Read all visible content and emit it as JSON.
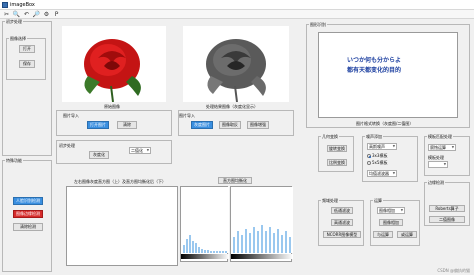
{
  "window": {
    "title": "imageBox"
  },
  "toolbar": {
    "tools": [
      "✂",
      "🔍",
      "↶",
      "🔎",
      "⚙",
      "P"
    ]
  },
  "left": {
    "group_img_select": "图像选择",
    "btn_open": "打开",
    "btn_save": "保存",
    "group_init": "初步处理",
    "group_special": "特殊功能",
    "btn_face": "人脸识别检测",
    "btn_license": "图像边缘检测",
    "btn_clear": "清除检测"
  },
  "center": {
    "original_caption": "原始图像",
    "processed_caption": "处理结果图像（灰度化显示）",
    "row1_label": "图片导入",
    "row1_btn_a": "打开图片",
    "row1_btn_b": "清除",
    "row2_label": "图片导入",
    "row2_btn_a": "灰度图片",
    "row2_btn_b": "图像取反",
    "row2_btn_c": "图像增强",
    "init_label": "初步处理",
    "init_btn": "灰度化",
    "binarize_select": "二值化",
    "hist_title": "直方图均衡化",
    "hist_caption_left": "左右图像灰度直方图（上）及直方图均衡化后（下）"
  },
  "right": {
    "group_recog": "图形识别",
    "canvas_text_line1": "いつか何も分からよ",
    "canvas_text_line2": "都有天都变化的目的",
    "axis_label": "图片格式转换（灰度图/二值图）",
    "group_geo": "几何变换",
    "btn_rotate": "旋转变换",
    "btn_scale": "比例变换",
    "group_noise": "噪声添加",
    "noise_select": "高斯噪声",
    "radio_3x3": "3x3模板",
    "radio_5x5": "5x5模板",
    "filter_select": "均值滤波器",
    "group_morph": "模板匹配处理",
    "morph_select": "腐蚀运算",
    "morph_btn_label": "模板处理",
    "group_edge": "边缘检测",
    "btn_roberts": "Roberts算子",
    "btn_ident": "二值图像",
    "group_freq": "频域处理",
    "btn_lowpass": "低通滤波",
    "btn_highpass": "高通滤波",
    "btn_homo": "NCORR图像模型",
    "group_ops": "运算",
    "ops_select": "图像相加",
    "btn_add": "图像相加",
    "btn_and": "与运算",
    "btn_or": "或运算"
  },
  "watermark": "CSDN @偏执的猫"
}
